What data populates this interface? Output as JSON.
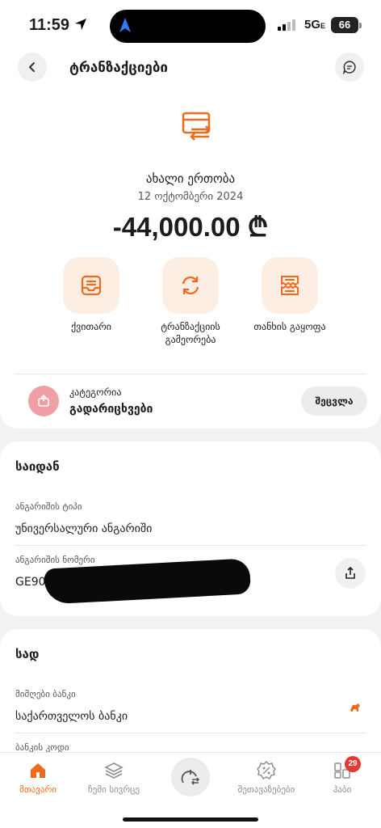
{
  "status_bar": {
    "time": "11:59",
    "network": "5G",
    "network_sub": "E",
    "battery": "66"
  },
  "header": {
    "title": "ტრანზაქციები",
    "back_icon": "chevron-left-icon",
    "chat_icon": "chat-icon"
  },
  "transaction": {
    "icon": "card-transfer-icon",
    "merchant": "ახალი ერთობა",
    "date": "12 ოქტომბერი 2024",
    "amount": "-44,000.00 ₾"
  },
  "actions": [
    {
      "label": "ქვითარი",
      "icon": "receipt-tray-icon"
    },
    {
      "label": "ტრანზაქციის გამეორება",
      "icon": "repeat-icon"
    },
    {
      "label": "თანხის გაყოფა",
      "icon": "split-receipt-icon"
    }
  ],
  "category": {
    "label": "კატეგორია",
    "value": "გადარიცხვები",
    "change_button": "შეცვლა",
    "icon": "transfer-box-icon"
  },
  "from": {
    "title": "საიდან",
    "account_type_label": "ანგარიშის ტიპი",
    "account_type_value": "უნივერსალური ანგარიში",
    "account_number_label": "ანგარიშის ნომერი",
    "account_number_value": "GE90BG",
    "share_icon": "share-icon"
  },
  "to": {
    "title": "სად",
    "bank_label": "მიმღები ბანკი",
    "bank_value": "საქართველოს ბანკი",
    "bank_code_label": "ბანკის კოდი",
    "bank_logo": "bank-lion-logo"
  },
  "tabs": [
    {
      "label": "მთავარი",
      "icon": "home-icon",
      "active": true
    },
    {
      "label": "ჩემი სივრცე",
      "icon": "layers-icon",
      "active": false
    },
    {
      "label": "",
      "icon": "transfer-center-icon",
      "active": false
    },
    {
      "label": "შეთავაზებები",
      "icon": "discount-icon",
      "active": false
    },
    {
      "label": "ჰაბი",
      "icon": "hub-grid-icon",
      "active": false,
      "badge": "29"
    }
  ],
  "colors": {
    "accent": "#f06a1d",
    "tile_bg": "#fdeee3",
    "category_icon_bg": "#ef9fa5",
    "badge": "#e53935"
  }
}
